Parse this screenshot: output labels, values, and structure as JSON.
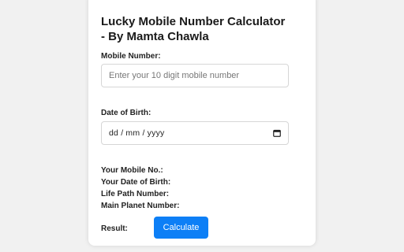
{
  "title": {
    "line1": "Lucky Mobile Number Calculator",
    "line2": "- By Mamta Chawla"
  },
  "mobile": {
    "label": "Mobile Number:",
    "placeholder": "Enter your 10 digit mobile number"
  },
  "dob": {
    "label": "Date of Birth:",
    "value": "dd / mm / yyyy",
    "icon": "calendar-icon"
  },
  "info": {
    "mobile_no": "Your Mobile No.:",
    "date_of_birth": "Your Date of Birth:",
    "life_path": "Life Path Number:",
    "main_planet": "Main Planet Number:"
  },
  "result_label": "Result:",
  "calculate_button": "Calculate",
  "colors": {
    "accent": "#0d7ff6",
    "background": "#f1f1f1",
    "card": "#ffffff"
  }
}
